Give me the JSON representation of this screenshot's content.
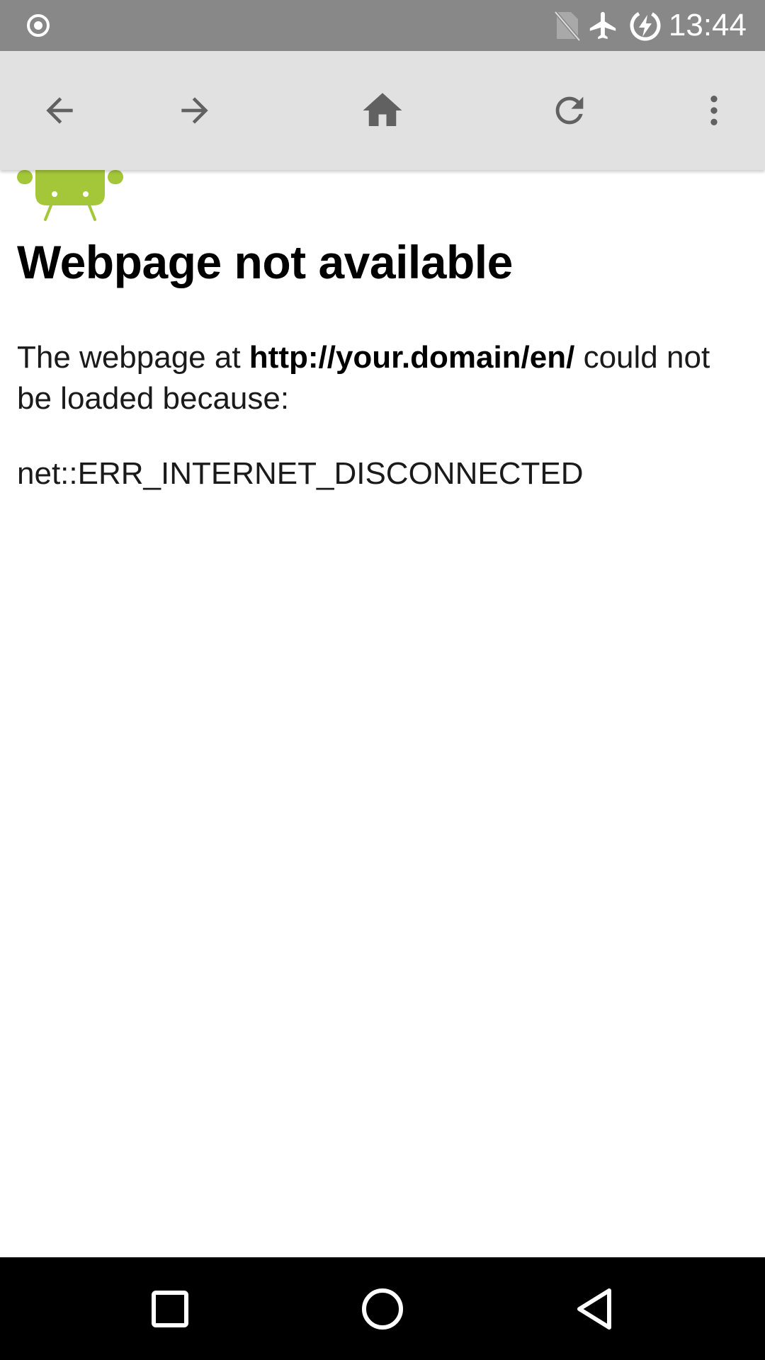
{
  "status_bar": {
    "time": "13:44",
    "icons": [
      "record-indicator-icon",
      "no-sim-icon",
      "airplane-mode-icon",
      "battery-charging-icon"
    ]
  },
  "toolbar": {
    "buttons": [
      "back-arrow-icon",
      "forward-arrow-icon",
      "home-icon",
      "reload-icon",
      "overflow-menu-icon"
    ],
    "icon_color": "#616161",
    "background": "#e1e1e1"
  },
  "error_page": {
    "title": "Webpage not available",
    "desc_prefix": "The webpage at ",
    "url": "http://your.domain/en/",
    "desc_suffix": " could not be loaded because:",
    "error_code": "net::ERR_INTERNET_DISCONNECTED",
    "robot_color": "#a4c639"
  },
  "nav_bar": {
    "buttons": [
      "recent-apps-icon",
      "home-circle-icon",
      "back-triangle-icon"
    ]
  }
}
